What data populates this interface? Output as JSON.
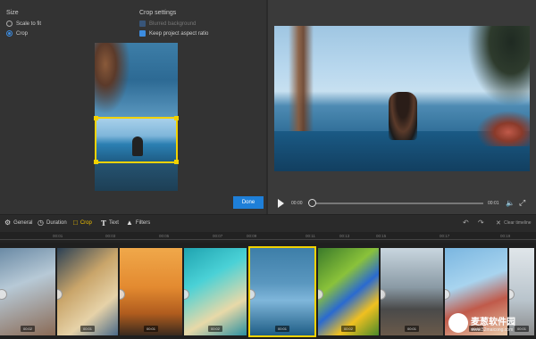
{
  "left_panel": {
    "size_label": "Size",
    "options": [
      {
        "label": "Scale to fit",
        "selected": false
      },
      {
        "label": "Crop",
        "selected": true
      }
    ],
    "crop_settings_label": "Crop settings",
    "checkboxes": [
      {
        "label": "Blurred background",
        "checked": true,
        "disabled": true
      },
      {
        "label": "Keep project aspect ratio",
        "checked": true,
        "disabled": false
      }
    ],
    "done_label": "Done"
  },
  "player": {
    "current_time": "00:00",
    "duration": "00:01",
    "progress": 0
  },
  "toolbar": {
    "tools": [
      {
        "label": "General",
        "icon": "gear-icon"
      },
      {
        "label": "Duration",
        "icon": "clock-icon"
      },
      {
        "label": "Crop",
        "icon": "crop-icon",
        "active": true
      },
      {
        "label": "Text",
        "icon": "text-icon"
      },
      {
        "label": "Filters",
        "icon": "filter-icon"
      }
    ],
    "clear_label": "Clear timeline"
  },
  "ruler": {
    "ticks": [
      "00:01",
      "00:03",
      "00:05",
      "00:07",
      "00:09",
      "00:11",
      "00:13",
      "00:15",
      "00:17",
      "00:19"
    ]
  },
  "timeline": {
    "clips": [
      {
        "badge": "00:02"
      },
      {
        "badge": "00:01"
      },
      {
        "badge": "00:01"
      },
      {
        "badge": "00:02"
      },
      {
        "badge": "00:01",
        "selected": true
      },
      {
        "badge": "00:02"
      },
      {
        "badge": "00:01"
      },
      {
        "badge": "00:02"
      },
      {
        "badge": "00:01"
      }
    ]
  },
  "watermark": {
    "title": "麦葱软件园",
    "url": "www.52maicong.com"
  },
  "colors": {
    "accent": "#1e7fd8",
    "selection": "#f2d200"
  }
}
